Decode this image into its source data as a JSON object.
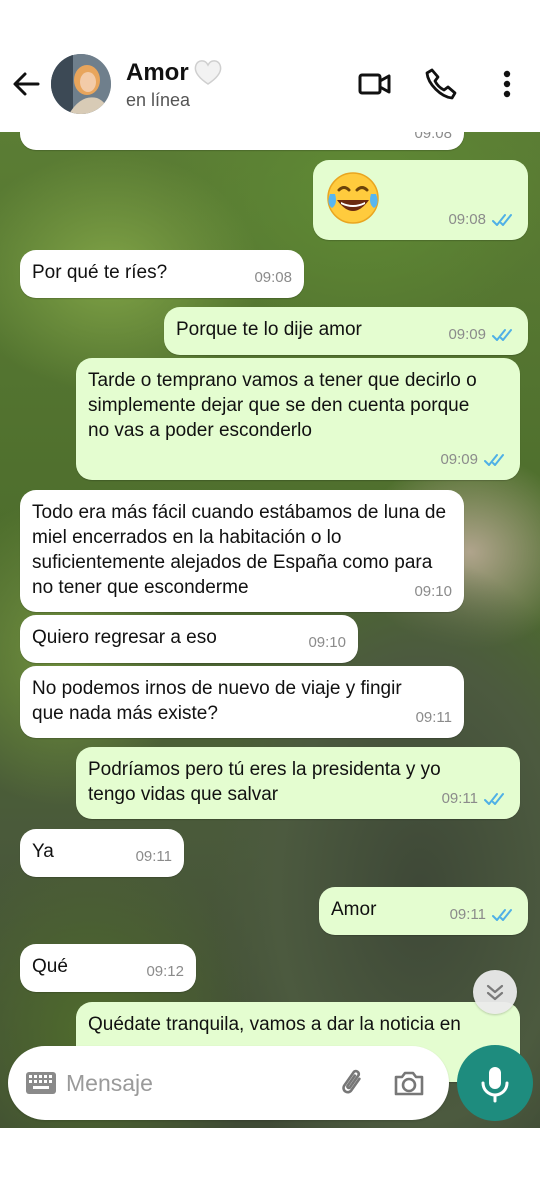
{
  "header": {
    "contact_name": "Amor",
    "status": "en línea"
  },
  "messages": [
    {
      "dir": "in",
      "text": "",
      "time": "09:08"
    },
    {
      "dir": "out",
      "emoji": "face-with-tears-of-joy",
      "text": "😂",
      "time": "09:08",
      "read": true
    },
    {
      "dir": "in",
      "text": "Por qué te ríes?",
      "time": "09:08"
    },
    {
      "dir": "out",
      "text": "Porque te lo dije amor",
      "time": "09:09",
      "read": true
    },
    {
      "dir": "out",
      "text": "Tarde o temprano vamos a tener que decirlo o simplemente dejar que se den cuenta porque no vas a poder esconderlo",
      "time": "09:09",
      "read": true
    },
    {
      "dir": "in",
      "text": "Todo era más fácil cuando estábamos de luna de miel encerrados en la habitación o lo suficientemente alejados de España como para no tener que esconderme",
      "time": "09:10"
    },
    {
      "dir": "in",
      "text": "Quiero regresar a eso",
      "time": "09:10"
    },
    {
      "dir": "in",
      "text": "No podemos irnos de nuevo de viaje y fingir que nada más existe?",
      "time": "09:11"
    },
    {
      "dir": "out",
      "text": "Podríamos pero tú eres la presidenta y yo tengo vidas que salvar",
      "time": "09:11",
      "read": true
    },
    {
      "dir": "in",
      "text": "Ya",
      "time": "09:11"
    },
    {
      "dir": "out",
      "text": "Amor",
      "time": "09:11",
      "read": true
    },
    {
      "dir": "in",
      "text": "Qué",
      "time": "09:12"
    },
    {
      "dir": "out",
      "text": "Quédate tranquila, vamos a dar la noticia  en",
      "time": "",
      "read": false
    }
  ],
  "composer": {
    "placeholder": "Mensaje"
  },
  "colors": {
    "outgoing_bubble": "#e4fdd0",
    "incoming_bubble": "#ffffff",
    "read_ticks": "#4fb0e6",
    "mic_button": "#1e8c7e"
  },
  "icons": [
    "back-arrow-icon",
    "heart-icon",
    "video-call-icon",
    "phone-icon",
    "more-options-icon",
    "scroll-down-icon",
    "keyboard-icon",
    "attach-icon",
    "camera-icon",
    "microphone-icon"
  ]
}
